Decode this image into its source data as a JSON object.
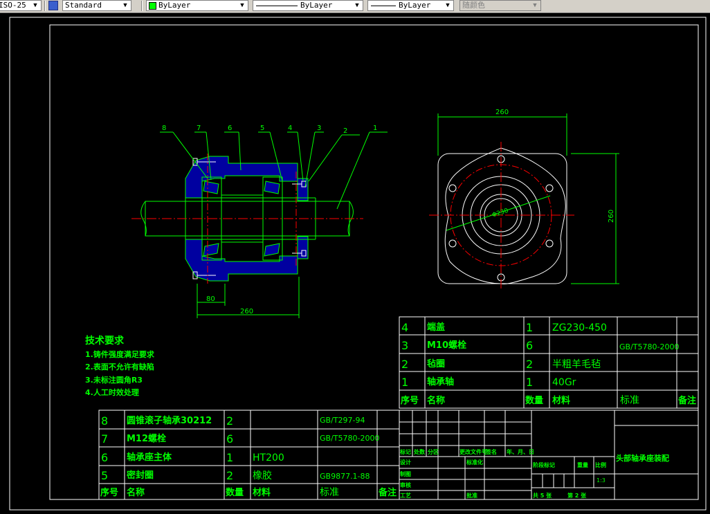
{
  "toolbar": {
    "dimstyle": "ISO-25",
    "textstyle": "Standard",
    "layer": "ByLayer",
    "linetype": "ByLayer",
    "lineweight": "ByLayer",
    "plotstyle": "随颜色"
  },
  "colors": {
    "frame": "#ffffff",
    "object": "#00ff00",
    "text": "#00ff00",
    "center": "#ff0000",
    "fill": "#0000a0",
    "white": "#ffffff"
  },
  "drawing": {
    "leaders": [
      "8",
      "7",
      "6",
      "5",
      "4",
      "3",
      "2",
      "1"
    ],
    "dims_left": {
      "d80": "80",
      "d260": "260"
    },
    "dims_right": {
      "width": "260",
      "height": "260",
      "dia": "Φ230"
    },
    "tech": {
      "title": "技术要求",
      "items": [
        "1.铸件强度满足要求",
        "2.表面不允许有缺陷",
        "3.未标注圆角R3",
        "4.人工时效处理"
      ]
    },
    "bom_upper": [
      {
        "no": "4",
        "name": "端盖",
        "qty": "1",
        "mat": "ZG230-450",
        "std": ""
      },
      {
        "no": "3",
        "name": "M10螺栓",
        "qty": "6",
        "mat": "",
        "std": "GB/T5780-2000"
      },
      {
        "no": "2",
        "name": "毡圈",
        "qty": "2",
        "mat": "半粗羊毛毡",
        "std": ""
      },
      {
        "no": "1",
        "name": "轴承轴",
        "qty": "1",
        "mat": "40Gr",
        "std": ""
      }
    ],
    "bom_upper_header": {
      "no": "序号",
      "name": "名称",
      "qty": "数量",
      "mat": "材料",
      "std": "标准",
      "note": "备注"
    },
    "bom_lower": [
      {
        "no": "8",
        "name": "圆锥滚子轴承30212",
        "qty": "2",
        "mat": "",
        "std": "GB/T297-94"
      },
      {
        "no": "7",
        "name": "M12螺栓",
        "qty": "6",
        "mat": "",
        "std": "GB/T5780-2000"
      },
      {
        "no": "6",
        "name": "轴承座主体",
        "qty": "1",
        "mat": "HT200",
        "std": ""
      },
      {
        "no": "5",
        "name": "密封圈",
        "qty": "2",
        "mat": "橡胶",
        "std": "GB9877.1-88"
      }
    ],
    "bom_lower_header": {
      "no": "序号",
      "name": "名称",
      "qty": "数量",
      "mat": "材料",
      "std": "标准",
      "note": "备注"
    },
    "title_block": {
      "title": "头部轴承座装配",
      "rev_labels": [
        "标记",
        "处数",
        "分区",
        "更改文件号",
        "签名",
        "年、月、日"
      ],
      "roles": [
        "设计",
        "制图",
        "审核",
        "工艺"
      ],
      "std_label": "标准化",
      "approve_label": "批准",
      "stage_label": "阶段标记",
      "weight_label": "重量",
      "scale_label": "比例",
      "scale_value": "1:3",
      "sheet_total": "共 5 张",
      "sheet_no": "第 2 张"
    }
  }
}
